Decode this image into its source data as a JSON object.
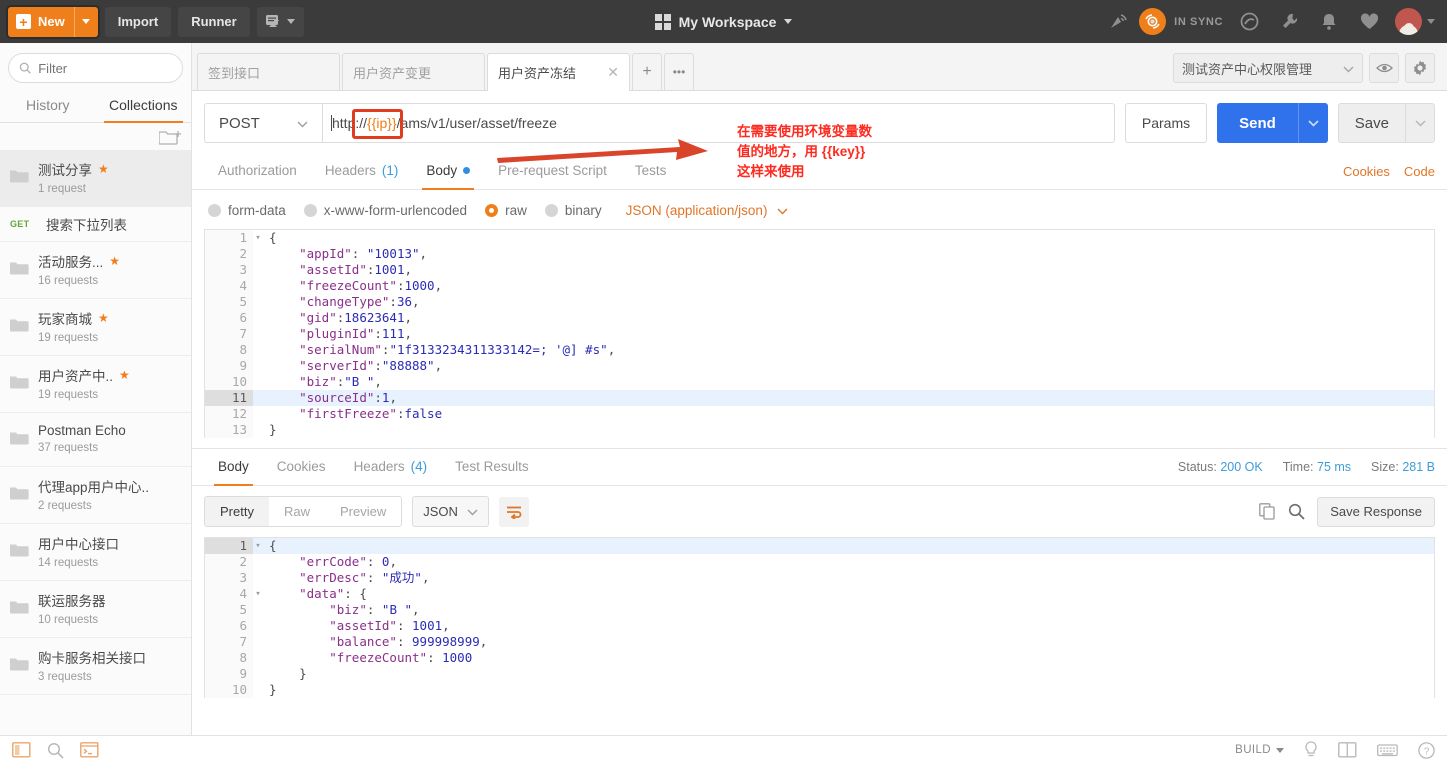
{
  "topbar": {
    "new_label": "New",
    "new_plus": "+",
    "import_label": "Import",
    "runner_label": "Runner",
    "new_tab_icon": "new-window-icon",
    "workspace_label": "My Workspace",
    "workspace_icon": "grid-icon",
    "sync_label": "IN SYNC",
    "satellite_icon": "broadcast-icon",
    "sync_icon": "sync-orb-icon",
    "interceptor_icon": "interceptor-icon",
    "wrench_icon": "wrench-icon",
    "bell_icon": "bell-icon",
    "heart_icon": "heart-icon",
    "avatar_icon": "user-avatar"
  },
  "sidebar": {
    "filter_placeholder": "Filter",
    "search_icon": "search-icon",
    "new_folder_icon": "new-folder-icon",
    "tabs": [
      {
        "label": "History",
        "active": false
      },
      {
        "label": "Collections",
        "active": true
      }
    ],
    "collections": [
      {
        "name": "测试分享",
        "count": "1 request",
        "starred": true,
        "selected": true,
        "type": "folder"
      },
      {
        "name": "搜索下拉列表",
        "verb": "GET",
        "type": "request"
      },
      {
        "name": "活动服务...",
        "count": "16 requests",
        "starred": true,
        "type": "folder"
      },
      {
        "name": "玩家商城",
        "count": "19 requests",
        "starred": true,
        "type": "folder"
      },
      {
        "name": "用户资产中..",
        "count": "19 requests",
        "starred": true,
        "type": "folder"
      },
      {
        "name": "Postman Echo",
        "count": "37 requests",
        "starred": false,
        "type": "folder"
      },
      {
        "name": "代理app用户中心..",
        "count": "2 requests",
        "starred": false,
        "type": "folder"
      },
      {
        "name": "用户中心接口",
        "count": "14 requests",
        "starred": false,
        "type": "folder"
      },
      {
        "name": "联运服务器",
        "count": "10 requests",
        "starred": false,
        "type": "folder"
      },
      {
        "name": "购卡服务相关接口",
        "count": "3 requests",
        "starred": false,
        "type": "folder"
      }
    ]
  },
  "tabstrip": {
    "tabs": [
      {
        "label": "签到接口",
        "active": false,
        "closable": false
      },
      {
        "label": "用户资产变更",
        "active": false,
        "closable": false
      },
      {
        "label": "用户资产冻结",
        "active": true,
        "closable": true
      }
    ],
    "close_icon": "close-icon",
    "add_label": "+",
    "more_label": "•••",
    "environment": "测试资产中心权限管理",
    "env_chevron_icon": "chevron-down-icon",
    "eye_icon": "eye-icon",
    "gear_icon": "gear-icon"
  },
  "request": {
    "method": "POST",
    "method_chevron_icon": "chevron-down-icon",
    "url_prefix": "http",
    "url_sep1": "://",
    "url_variable": "{{ip}}",
    "url_suffix": "/ams/v1/user/asset/freeze",
    "url_full": "http://{{ip}}/ams/v1/user/asset/freeze",
    "params_label": "Params",
    "send_label": "Send",
    "save_label": "Save",
    "tabs": [
      {
        "label": "Authorization",
        "active": false,
        "count": "",
        "dot": false
      },
      {
        "label": "Headers",
        "active": false,
        "count": "(1)",
        "dot": false
      },
      {
        "label": "Body",
        "active": true,
        "count": "",
        "dot": true
      },
      {
        "label": "Pre-request Script",
        "active": false,
        "count": "",
        "dot": false
      },
      {
        "label": "Tests",
        "active": false,
        "count": "",
        "dot": false
      }
    ],
    "cookies_link": "Cookies",
    "code_link": "Code",
    "body_types": [
      {
        "label": "form-data",
        "selected": false
      },
      {
        "label": "x-www-form-urlencoded",
        "selected": false
      },
      {
        "label": "raw",
        "selected": true
      },
      {
        "label": "binary",
        "selected": false
      }
    ],
    "content_type": "JSON (application/json)",
    "content_type_chevron_icon": "chevron-down-icon",
    "body_lines": [
      {
        "n": "1",
        "fold": true,
        "text": "{",
        "hl": false
      },
      {
        "n": "2",
        "fold": false,
        "text": "    \"appId\": \"10013\",",
        "hl": false
      },
      {
        "n": "3",
        "fold": false,
        "text": "    \"assetId\":1001,",
        "hl": false
      },
      {
        "n": "4",
        "fold": false,
        "text": "    \"freezeCount\":1000,",
        "hl": false
      },
      {
        "n": "5",
        "fold": false,
        "text": "    \"changeType\":36,",
        "hl": false
      },
      {
        "n": "6",
        "fold": false,
        "text": "    \"gid\":18623641,",
        "hl": false
      },
      {
        "n": "7",
        "fold": false,
        "text": "    \"pluginId\":111,",
        "hl": false
      },
      {
        "n": "8",
        "fold": false,
        "text": "    \"serialNum\":\"1f3133234311333142=; '@] #s\",",
        "hl": false
      },
      {
        "n": "9",
        "fold": false,
        "text": "    \"serverId\":\"88888\",",
        "hl": false
      },
      {
        "n": "10",
        "fold": false,
        "text": "    \"biz\":\"B \",",
        "hl": false
      },
      {
        "n": "11",
        "fold": false,
        "text": "    \"sourceId\":1,",
        "hl": true
      },
      {
        "n": "12",
        "fold": false,
        "text": "    \"firstFreeze\":false",
        "hl": false
      },
      {
        "n": "13",
        "fold": false,
        "text": "}",
        "hl": false
      }
    ]
  },
  "annotation": {
    "line1": "在需要使用环境变量数",
    "line2": "值的地方，用 {{key}}",
    "line3": "这样来使用",
    "color": "#ff2a1f",
    "arrow_icon": "arrow-right-icon"
  },
  "response": {
    "tabs": [
      {
        "label": "Body",
        "active": true,
        "count": ""
      },
      {
        "label": "Cookies",
        "active": false,
        "count": ""
      },
      {
        "label": "Headers",
        "active": false,
        "count": "(4)"
      },
      {
        "label": "Test Results",
        "active": false,
        "count": ""
      }
    ],
    "status_label": "Status:",
    "status_value": "200 OK",
    "time_label": "Time:",
    "time_value": "75 ms",
    "size_label": "Size:",
    "size_value": "281 B",
    "view_modes": [
      {
        "label": "Pretty",
        "active": true
      },
      {
        "label": "Raw",
        "active": false
      },
      {
        "label": "Preview",
        "active": false
      }
    ],
    "format": "JSON",
    "format_chevron_icon": "chevron-down-icon",
    "wrap_icon": "word-wrap-icon",
    "copy_icon": "copy-icon",
    "find_icon": "search-icon",
    "save_response_label": "Save Response",
    "body_lines": [
      {
        "n": "1",
        "fold": true,
        "text": "{",
        "hl": true
      },
      {
        "n": "2",
        "fold": false,
        "text": "    \"errCode\": 0,",
        "hl": false
      },
      {
        "n": "3",
        "fold": false,
        "text": "    \"errDesc\": \"成功\",",
        "hl": false
      },
      {
        "n": "4",
        "fold": true,
        "text": "    \"data\": {",
        "hl": false
      },
      {
        "n": "5",
        "fold": false,
        "text": "        \"biz\": \"B \",",
        "hl": false
      },
      {
        "n": "6",
        "fold": false,
        "text": "        \"assetId\": 1001,",
        "hl": false
      },
      {
        "n": "7",
        "fold": false,
        "text": "        \"balance\": 999998999,",
        "hl": false
      },
      {
        "n": "8",
        "fold": false,
        "text": "        \"freezeCount\": 1000",
        "hl": false
      },
      {
        "n": "9",
        "fold": false,
        "text": "    }",
        "hl": false
      },
      {
        "n": "10",
        "fold": false,
        "text": "}",
        "hl": false
      }
    ]
  },
  "statusbar": {
    "sidebar_toggle_icon": "sidebar-toggle-icon",
    "find_icon": "search-icon",
    "console_icon": "console-icon",
    "build_label": "BUILD",
    "build_caret_icon": "caret-down-icon",
    "bulb_icon": "bulb-icon",
    "layout_icon": "two-pane-icon",
    "keyboard_icon": "keyboard-icon",
    "help_icon": "help-icon"
  }
}
